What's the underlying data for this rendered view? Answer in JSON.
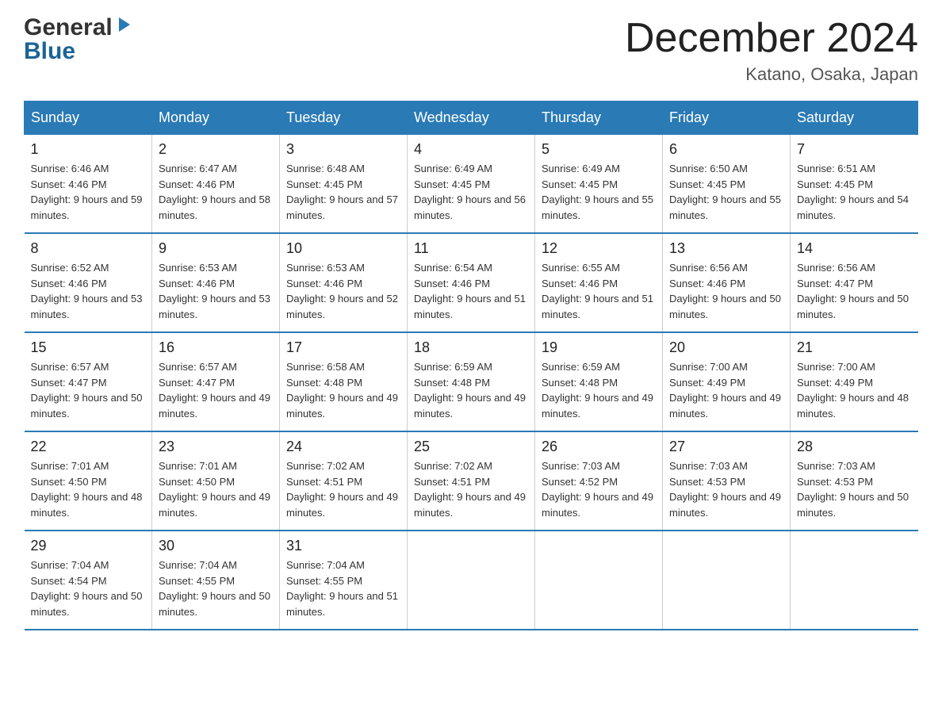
{
  "logo": {
    "line1": "General",
    "line2": "Blue"
  },
  "title": "December 2024",
  "location": "Katano, Osaka, Japan",
  "days_of_week": [
    "Sunday",
    "Monday",
    "Tuesday",
    "Wednesday",
    "Thursday",
    "Friday",
    "Saturday"
  ],
  "weeks": [
    [
      {
        "day": "1",
        "sunrise": "Sunrise: 6:46 AM",
        "sunset": "Sunset: 4:46 PM",
        "daylight": "Daylight: 9 hours and 59 minutes."
      },
      {
        "day": "2",
        "sunrise": "Sunrise: 6:47 AM",
        "sunset": "Sunset: 4:46 PM",
        "daylight": "Daylight: 9 hours and 58 minutes."
      },
      {
        "day": "3",
        "sunrise": "Sunrise: 6:48 AM",
        "sunset": "Sunset: 4:45 PM",
        "daylight": "Daylight: 9 hours and 57 minutes."
      },
      {
        "day": "4",
        "sunrise": "Sunrise: 6:49 AM",
        "sunset": "Sunset: 4:45 PM",
        "daylight": "Daylight: 9 hours and 56 minutes."
      },
      {
        "day": "5",
        "sunrise": "Sunrise: 6:49 AM",
        "sunset": "Sunset: 4:45 PM",
        "daylight": "Daylight: 9 hours and 55 minutes."
      },
      {
        "day": "6",
        "sunrise": "Sunrise: 6:50 AM",
        "sunset": "Sunset: 4:45 PM",
        "daylight": "Daylight: 9 hours and 55 minutes."
      },
      {
        "day": "7",
        "sunrise": "Sunrise: 6:51 AM",
        "sunset": "Sunset: 4:45 PM",
        "daylight": "Daylight: 9 hours and 54 minutes."
      }
    ],
    [
      {
        "day": "8",
        "sunrise": "Sunrise: 6:52 AM",
        "sunset": "Sunset: 4:46 PM",
        "daylight": "Daylight: 9 hours and 53 minutes."
      },
      {
        "day": "9",
        "sunrise": "Sunrise: 6:53 AM",
        "sunset": "Sunset: 4:46 PM",
        "daylight": "Daylight: 9 hours and 53 minutes."
      },
      {
        "day": "10",
        "sunrise": "Sunrise: 6:53 AM",
        "sunset": "Sunset: 4:46 PM",
        "daylight": "Daylight: 9 hours and 52 minutes."
      },
      {
        "day": "11",
        "sunrise": "Sunrise: 6:54 AM",
        "sunset": "Sunset: 4:46 PM",
        "daylight": "Daylight: 9 hours and 51 minutes."
      },
      {
        "day": "12",
        "sunrise": "Sunrise: 6:55 AM",
        "sunset": "Sunset: 4:46 PM",
        "daylight": "Daylight: 9 hours and 51 minutes."
      },
      {
        "day": "13",
        "sunrise": "Sunrise: 6:56 AM",
        "sunset": "Sunset: 4:46 PM",
        "daylight": "Daylight: 9 hours and 50 minutes."
      },
      {
        "day": "14",
        "sunrise": "Sunrise: 6:56 AM",
        "sunset": "Sunset: 4:47 PM",
        "daylight": "Daylight: 9 hours and 50 minutes."
      }
    ],
    [
      {
        "day": "15",
        "sunrise": "Sunrise: 6:57 AM",
        "sunset": "Sunset: 4:47 PM",
        "daylight": "Daylight: 9 hours and 50 minutes."
      },
      {
        "day": "16",
        "sunrise": "Sunrise: 6:57 AM",
        "sunset": "Sunset: 4:47 PM",
        "daylight": "Daylight: 9 hours and 49 minutes."
      },
      {
        "day": "17",
        "sunrise": "Sunrise: 6:58 AM",
        "sunset": "Sunset: 4:48 PM",
        "daylight": "Daylight: 9 hours and 49 minutes."
      },
      {
        "day": "18",
        "sunrise": "Sunrise: 6:59 AM",
        "sunset": "Sunset: 4:48 PM",
        "daylight": "Daylight: 9 hours and 49 minutes."
      },
      {
        "day": "19",
        "sunrise": "Sunrise: 6:59 AM",
        "sunset": "Sunset: 4:48 PM",
        "daylight": "Daylight: 9 hours and 49 minutes."
      },
      {
        "day": "20",
        "sunrise": "Sunrise: 7:00 AM",
        "sunset": "Sunset: 4:49 PM",
        "daylight": "Daylight: 9 hours and 49 minutes."
      },
      {
        "day": "21",
        "sunrise": "Sunrise: 7:00 AM",
        "sunset": "Sunset: 4:49 PM",
        "daylight": "Daylight: 9 hours and 48 minutes."
      }
    ],
    [
      {
        "day": "22",
        "sunrise": "Sunrise: 7:01 AM",
        "sunset": "Sunset: 4:50 PM",
        "daylight": "Daylight: 9 hours and 48 minutes."
      },
      {
        "day": "23",
        "sunrise": "Sunrise: 7:01 AM",
        "sunset": "Sunset: 4:50 PM",
        "daylight": "Daylight: 9 hours and 49 minutes."
      },
      {
        "day": "24",
        "sunrise": "Sunrise: 7:02 AM",
        "sunset": "Sunset: 4:51 PM",
        "daylight": "Daylight: 9 hours and 49 minutes."
      },
      {
        "day": "25",
        "sunrise": "Sunrise: 7:02 AM",
        "sunset": "Sunset: 4:51 PM",
        "daylight": "Daylight: 9 hours and 49 minutes."
      },
      {
        "day": "26",
        "sunrise": "Sunrise: 7:03 AM",
        "sunset": "Sunset: 4:52 PM",
        "daylight": "Daylight: 9 hours and 49 minutes."
      },
      {
        "day": "27",
        "sunrise": "Sunrise: 7:03 AM",
        "sunset": "Sunset: 4:53 PM",
        "daylight": "Daylight: 9 hours and 49 minutes."
      },
      {
        "day": "28",
        "sunrise": "Sunrise: 7:03 AM",
        "sunset": "Sunset: 4:53 PM",
        "daylight": "Daylight: 9 hours and 50 minutes."
      }
    ],
    [
      {
        "day": "29",
        "sunrise": "Sunrise: 7:04 AM",
        "sunset": "Sunset: 4:54 PM",
        "daylight": "Daylight: 9 hours and 50 minutes."
      },
      {
        "day": "30",
        "sunrise": "Sunrise: 7:04 AM",
        "sunset": "Sunset: 4:55 PM",
        "daylight": "Daylight: 9 hours and 50 minutes."
      },
      {
        "day": "31",
        "sunrise": "Sunrise: 7:04 AM",
        "sunset": "Sunset: 4:55 PM",
        "daylight": "Daylight: 9 hours and 51 minutes."
      },
      null,
      null,
      null,
      null
    ]
  ]
}
